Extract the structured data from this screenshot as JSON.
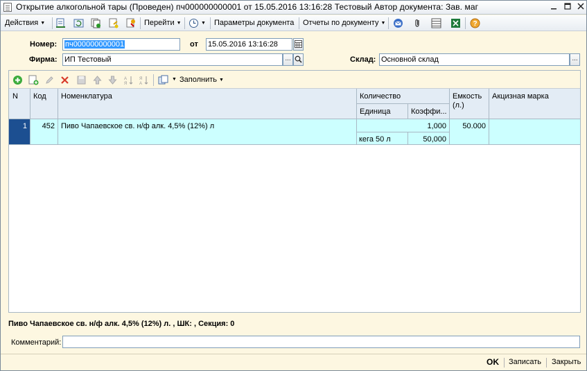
{
  "window": {
    "title": "Открытие алкогольной тары (Проведен)  пч000000000001 от 15.05.2016 13:16:28 Тестовый Автор документа: Зав. маг"
  },
  "toolbar": {
    "actions_label": "Действия",
    "goto_label": "Перейти",
    "params_label": "Параметры документа",
    "reports_label": "Отчеты по документу"
  },
  "form": {
    "number_label": "Номер:",
    "number_value": "пч000000000001",
    "from_label": "от",
    "date_value": "15.05.2016 13:16:28",
    "firm_label": "Фирма:",
    "firm_value": "ИП Тестовый",
    "warehouse_label": "Склад:",
    "warehouse_value": "Основной склад"
  },
  "table_toolbar": {
    "fill_label": "Заполнить"
  },
  "table": {
    "headers": {
      "n": "N",
      "code": "Код",
      "nomenclature": "Номенклатура",
      "quantity": "Количество",
      "unit": "Единица",
      "coef": "Коэффи...",
      "capacity": "Емкость (л.)",
      "excise": "Акцизная марка"
    },
    "rows": [
      {
        "n": "1",
        "code": "452",
        "nomenclature": "Пиво Чапаевское св. н/ф алк. 4,5% (12%) л",
        "quantity": "1,000",
        "unit": "кега 50 л",
        "coef": "50,000",
        "capacity": "50.000",
        "excise": ""
      }
    ]
  },
  "status": {
    "text": "Пиво Чапаевское св. н/ф алк. 4,5% (12%) л. , ШК: , Секция: 0"
  },
  "comment": {
    "label": "Комментарий:",
    "value": ""
  },
  "buttons": {
    "ok": "OK",
    "save": "Записать",
    "close": "Закрыть"
  },
  "colors": {
    "form_bg": "#fdf7e1",
    "header_bg": "#e3ecf5",
    "row_bg": "#ccffff",
    "row_marker": "#1c4f91",
    "selection": "#3399ff"
  }
}
